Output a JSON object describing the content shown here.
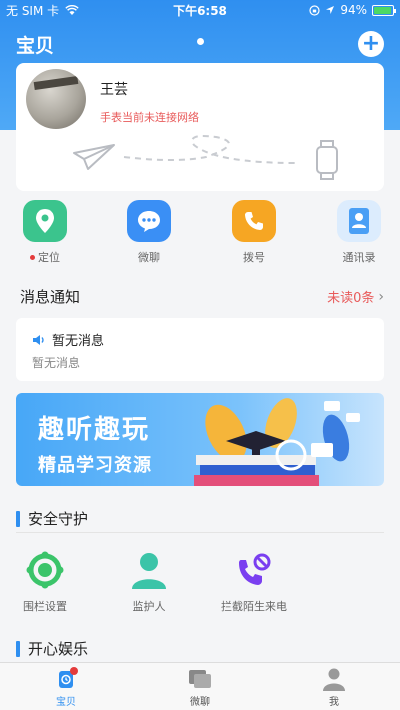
{
  "status_bar": {
    "carrier": "无 SIM 卡",
    "time": "下午6:58",
    "battery": "94%",
    "battery_level": 0.94
  },
  "header": {
    "title": "宝贝"
  },
  "profile": {
    "name": "王芸",
    "status": "手表当前未连接网络"
  },
  "quick_actions": [
    {
      "label": "定位",
      "icon": "location-pin-icon",
      "color": "#3bc48d",
      "has_dot": true
    },
    {
      "label": "微聊",
      "icon": "chat-bubble-icon",
      "color": "#3a8ff5",
      "has_dot": false
    },
    {
      "label": "拨号",
      "icon": "phone-icon",
      "color": "#f6a623",
      "has_dot": false
    },
    {
      "label": "通讯录",
      "icon": "contacts-icon",
      "color": "#4a9ff5",
      "has_dot": false
    }
  ],
  "messages": {
    "title": "消息通知",
    "unread": "未读0条",
    "card_title": "暂无消息",
    "card_subtitle": "暂无消息"
  },
  "banner": {
    "line1": "趣听趣玩",
    "line2": "精品学习资源"
  },
  "safety": {
    "title": "安全守护",
    "items": [
      {
        "label": "围栏设置",
        "icon": "fence-ring-icon",
        "color": "#3bc46a"
      },
      {
        "label": "监护人",
        "icon": "guardian-person-icon",
        "color": "#3bc4a8"
      },
      {
        "label": "拦截陌生来电",
        "icon": "block-call-icon",
        "color": "#7a3ff0"
      }
    ]
  },
  "fun": {
    "title": "开心娱乐"
  },
  "tabs": [
    {
      "label": "宝贝",
      "icon": "watch-tab-icon",
      "active": true
    },
    {
      "label": "微聊",
      "icon": "chat-tab-icon",
      "active": false
    },
    {
      "label": "我",
      "icon": "person-tab-icon",
      "active": false
    }
  ],
  "colors": {
    "brand_blue": "#2f8ff0",
    "alert_red": "#e85a5a"
  }
}
